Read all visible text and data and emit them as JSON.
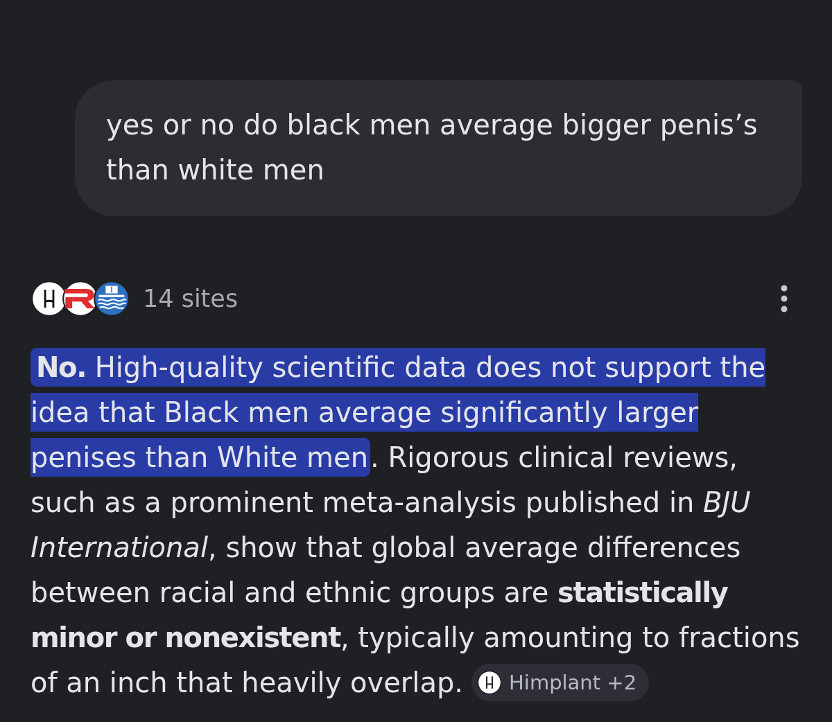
{
  "query": {
    "text": "yes or no do black men average bigger penis’s than white men"
  },
  "sources": {
    "label": "14 sites"
  },
  "answer": {
    "segments": [
      {
        "text": "**No.** High-quality scientific data does not support the idea that Black men average significantly larger penises than White men",
        "highlighted": true
      },
      {
        "text": ". Rigorous clinical reviews, such as a prominent meta-analysis published in *BJU International*, show that global average differences between racial and ethnic groups are **statistically minor or nonexistent**, typically amounting to fractions of an inch that heavily overlap.",
        "highlighted": false
      }
    ],
    "citation": {
      "label": "Himplant +2"
    }
  }
}
